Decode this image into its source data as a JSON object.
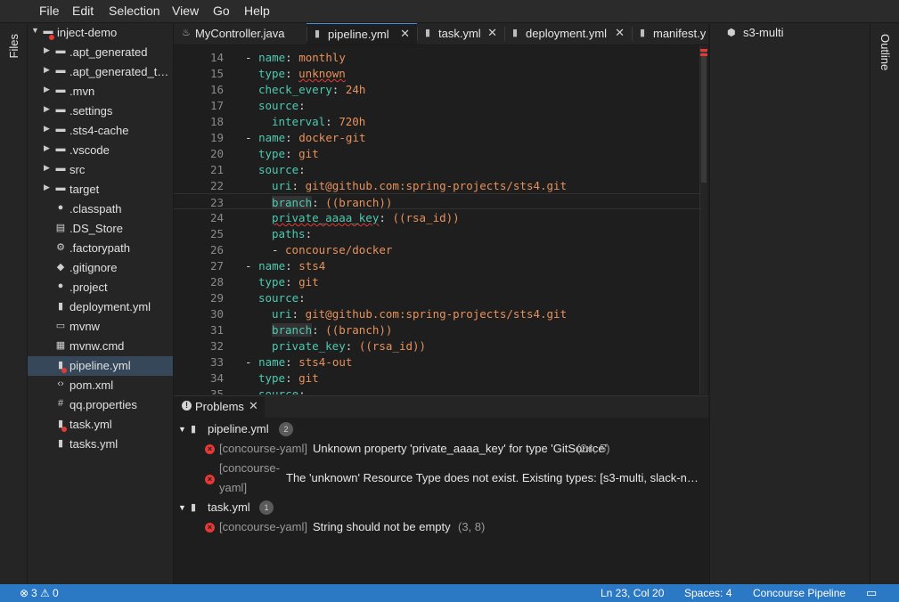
{
  "menu": [
    "File",
    "Edit",
    "Selection",
    "View",
    "Go",
    "Help"
  ],
  "left_panel_label": "Files",
  "right_panel_label": "Outline",
  "explorer": {
    "items": [
      {
        "label": "inject-demo",
        "icon": "folder-open-icon",
        "twisty": "open",
        "depth": 0,
        "error": true
      },
      {
        "label": ".apt_generated",
        "icon": "folder-icon",
        "twisty": "closed",
        "depth": 1
      },
      {
        "label": ".apt_generated_t…",
        "icon": "folder-icon",
        "twisty": "closed",
        "depth": 1
      },
      {
        "label": ".mvn",
        "icon": "folder-icon",
        "twisty": "closed",
        "depth": 1
      },
      {
        "label": ".settings",
        "icon": "folder-icon",
        "twisty": "closed",
        "depth": 1
      },
      {
        "label": ".sts4-cache",
        "icon": "folder-icon",
        "twisty": "closed",
        "depth": 1
      },
      {
        "label": ".vscode",
        "icon": "folder-icon",
        "twisty": "closed",
        "depth": 1
      },
      {
        "label": "src",
        "icon": "folder-icon",
        "twisty": "closed",
        "depth": 1
      },
      {
        "label": "target",
        "icon": "folder-icon",
        "twisty": "closed",
        "depth": 1
      },
      {
        "label": ".classpath",
        "icon": "circle-file-icon",
        "twisty": "none",
        "depth": 1
      },
      {
        "label": ".DS_Store",
        "icon": "binary-file-icon",
        "twisty": "none",
        "depth": 1
      },
      {
        "label": ".factorypath",
        "icon": "gear-file-icon",
        "twisty": "none",
        "depth": 1
      },
      {
        "label": ".gitignore",
        "icon": "diamond-file-icon",
        "twisty": "none",
        "depth": 1
      },
      {
        "label": ".project",
        "icon": "circle-file-icon",
        "twisty": "none",
        "depth": 1
      },
      {
        "label": "deployment.yml",
        "icon": "yaml-file-icon",
        "twisty": "none",
        "depth": 1
      },
      {
        "label": "mvnw",
        "icon": "terminal-file-icon",
        "twisty": "none",
        "depth": 1
      },
      {
        "label": "mvnw.cmd",
        "icon": "windows-file-icon",
        "twisty": "none",
        "depth": 1
      },
      {
        "label": "pipeline.yml",
        "icon": "yaml-file-icon",
        "twisty": "none",
        "depth": 1,
        "selected": true,
        "error": true
      },
      {
        "label": "pom.xml",
        "icon": "code-file-icon",
        "twisty": "none",
        "depth": 1
      },
      {
        "label": "qq.properties",
        "icon": "hash-file-icon",
        "twisty": "none",
        "depth": 1
      },
      {
        "label": "task.yml",
        "icon": "yaml-file-icon",
        "twisty": "none",
        "depth": 1,
        "error": true
      },
      {
        "label": "tasks.yml",
        "icon": "yaml-file-icon",
        "twisty": "none",
        "depth": 1
      }
    ]
  },
  "tabs": [
    {
      "label": "MyController.java",
      "icon": "java-file-icon",
      "active": false,
      "closable": false
    },
    {
      "label": "pipeline.yml",
      "icon": "yaml-file-icon",
      "active": true,
      "closable": true
    },
    {
      "label": "task.yml",
      "icon": "yaml-file-icon",
      "active": false,
      "closable": true
    },
    {
      "label": "deployment.yml",
      "icon": "yaml-file-icon",
      "active": false,
      "closable": true
    },
    {
      "label": "manifest.y",
      "icon": "yaml-file-icon",
      "active": false,
      "closable": false
    }
  ],
  "editor": {
    "current_line": 23,
    "lines": [
      {
        "n": "14",
        "indent": 0,
        "dash": true,
        "key": "name",
        "value": "monthly"
      },
      {
        "n": "15",
        "indent": 1,
        "key": "type",
        "value": "unknown",
        "squiggle": "value"
      },
      {
        "n": "16",
        "indent": 1,
        "key": "check_every",
        "value": "24h"
      },
      {
        "n": "17",
        "indent": 1,
        "key": "source",
        "value": ""
      },
      {
        "n": "18",
        "indent": 2,
        "key": "interval",
        "value": "720h"
      },
      {
        "n": "19",
        "indent": 0,
        "dash": true,
        "key": "name",
        "value": "docker-git"
      },
      {
        "n": "20",
        "indent": 1,
        "key": "type",
        "value": "git"
      },
      {
        "n": "21",
        "indent": 1,
        "key": "source",
        "value": ""
      },
      {
        "n": "22",
        "indent": 2,
        "key": "uri",
        "value": "git@github.com:spring-projects/sts4.git"
      },
      {
        "n": "23",
        "indent": 2,
        "key": "branch",
        "value": "((branch))",
        "highlight": true
      },
      {
        "n": "24",
        "indent": 2,
        "key": "private_aaaa_key",
        "value": "((rsa_id))",
        "squiggle": "key"
      },
      {
        "n": "25",
        "indent": 2,
        "key": "paths",
        "value": ""
      },
      {
        "n": "26",
        "indent": 2,
        "dash": true,
        "key": "",
        "value": "concourse/docker"
      },
      {
        "n": "27",
        "indent": 0,
        "dash": true,
        "key": "name",
        "value": "sts4"
      },
      {
        "n": "28",
        "indent": 1,
        "key": "type",
        "value": "git"
      },
      {
        "n": "29",
        "indent": 1,
        "key": "source",
        "value": ""
      },
      {
        "n": "30",
        "indent": 2,
        "key": "uri",
        "value": "git@github.com:spring-projects/sts4.git"
      },
      {
        "n": "31",
        "indent": 2,
        "key": "branch",
        "value": "((branch))",
        "highlight": true
      },
      {
        "n": "32",
        "indent": 2,
        "key": "private_key",
        "value": "((rsa_id))"
      },
      {
        "n": "33",
        "indent": 0,
        "dash": true,
        "key": "name",
        "value": "sts4-out"
      },
      {
        "n": "34",
        "indent": 1,
        "key": "type",
        "value": "git"
      },
      {
        "n": "35",
        "indent": 1,
        "key": "source",
        "value": ""
      }
    ]
  },
  "problems": {
    "tab_label": "Problems",
    "groups": [
      {
        "file": "pipeline.yml",
        "count": "2",
        "items": [
          {
            "source": "[concourse-yaml]",
            "message": "Unknown property 'private_aaaa_key' for type 'GitSource'",
            "location": "(24, 5)"
          },
          {
            "source_line1": "[concourse-",
            "source_line2": "yaml]",
            "message": "The 'unknown' Resource Type does not exist. Existing types: [s3-multi, slack-n…",
            "location": ""
          }
        ]
      },
      {
        "file": "task.yml",
        "count": "1",
        "items": [
          {
            "source": "[concourse-yaml]",
            "message": "String should not be empty",
            "location": "(3, 8)"
          }
        ]
      }
    ]
  },
  "outline": {
    "item_label": "s3-multi",
    "icon": "module-icon"
  },
  "status": {
    "errors": "3",
    "warnings": "0",
    "position": "Ln 23, Col 20",
    "spaces": "Spaces: 4",
    "language": "Concourse Pipeline",
    "feedback_icon": "feedback-icon"
  },
  "colors": {
    "accent": "#2b78c5",
    "key": "#4ec9b0",
    "value": "#e8915c",
    "error": "#e53935"
  }
}
